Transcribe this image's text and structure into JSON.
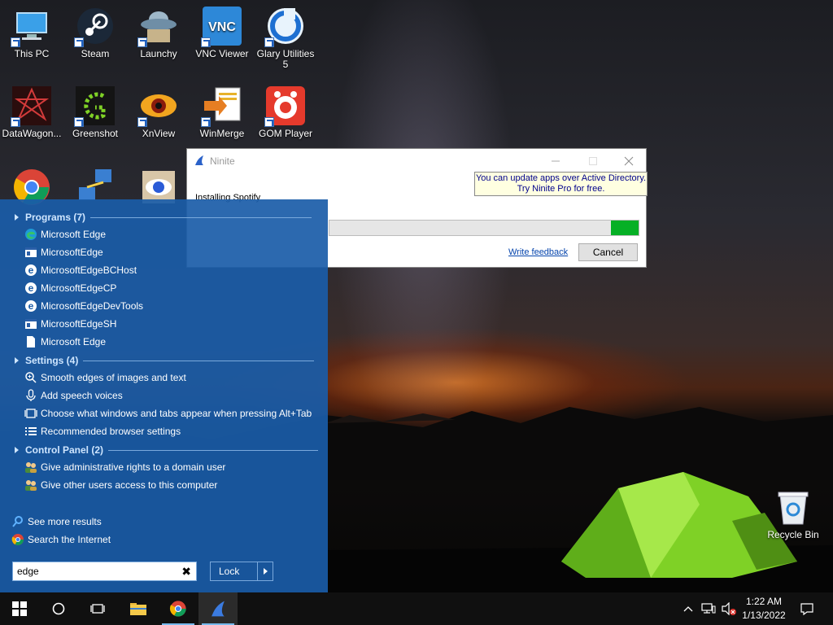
{
  "desktop": {
    "icons": [
      {
        "label": "This PC",
        "icon": "computer-icon"
      },
      {
        "label": "Steam",
        "icon": "steam-icon"
      },
      {
        "label": "Launchy",
        "icon": "launchy-icon"
      },
      {
        "label": "VNC Viewer",
        "icon": "vnc-icon"
      },
      {
        "label": "Glary Utilities 5",
        "icon": "glary-icon"
      },
      {
        "label": "DataWagon...",
        "icon": "datawagon-icon"
      },
      {
        "label": "Greenshot",
        "icon": "greenshot-icon"
      },
      {
        "label": "XnView",
        "icon": "xnview-icon"
      },
      {
        "label": "WinMerge",
        "icon": "winmerge-icon"
      },
      {
        "label": "GOM Player",
        "icon": "gom-icon"
      }
    ],
    "recycle_bin": "Recycle Bin"
  },
  "ninite": {
    "title": "Ninite",
    "promo_line1": "You can update apps over Active Directory.",
    "promo_line2": "Try Ninite Pro for free.",
    "status": "Installing Spotify",
    "progress": 0.09,
    "feedback_link": "Write feedback",
    "cancel_label": "Cancel"
  },
  "start_search": {
    "sections": [
      {
        "label": "Programs (7)",
        "items": [
          {
            "label": "Microsoft Edge",
            "icon": "edge-icon"
          },
          {
            "label": "MicrosoftEdge",
            "icon": "app-window-icon"
          },
          {
            "label": "MicrosoftEdgeBCHost",
            "icon": "edge-legacy-icon"
          },
          {
            "label": "MicrosoftEdgeCP",
            "icon": "edge-legacy-icon"
          },
          {
            "label": "MicrosoftEdgeDevTools",
            "icon": "edge-legacy-icon"
          },
          {
            "label": "MicrosoftEdgeSH",
            "icon": "app-window-icon"
          },
          {
            "label": "Microsoft Edge",
            "icon": "document-icon"
          }
        ]
      },
      {
        "label": "Settings (4)",
        "items": [
          {
            "label": "Smooth edges of images and text",
            "icon": "magnifier-icon"
          },
          {
            "label": "Add speech voices",
            "icon": "microphone-icon"
          },
          {
            "label": "Choose what windows and tabs appear when pressing Alt+Tab",
            "icon": "multitask-icon"
          },
          {
            "label": "Recommended browser settings",
            "icon": "list-icon"
          }
        ]
      },
      {
        "label": "Control Panel (2)",
        "items": [
          {
            "label": "Give administrative rights to a domain user",
            "icon": "users-icon"
          },
          {
            "label": "Give other users access to this computer",
            "icon": "users-icon"
          }
        ]
      }
    ],
    "see_more": "See more results",
    "search_internet": "Search the Internet",
    "query": "edge",
    "lock_label": "Lock"
  },
  "taskbar": {
    "time": "1:22 AM",
    "date": "1/13/2022"
  },
  "colors": {
    "start_bg": "#1a5ca8",
    "taskbar_bg": "#101010",
    "progress_fill": "#06b025",
    "link": "#0645ad"
  }
}
